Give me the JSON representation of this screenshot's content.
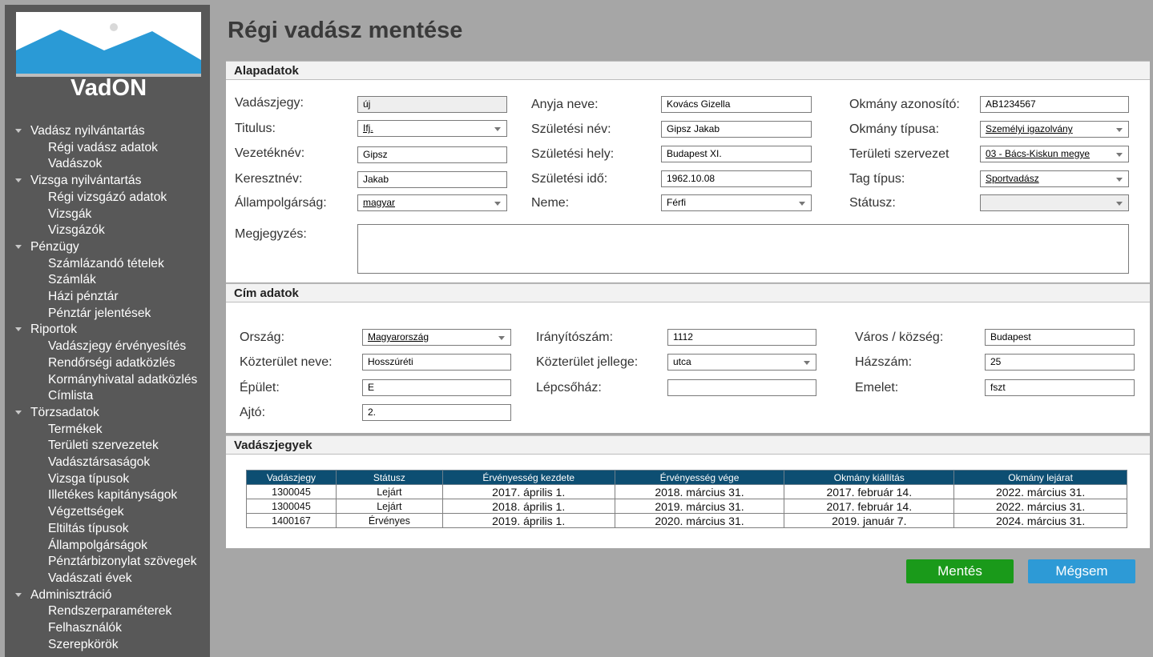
{
  "app": {
    "brand": "VadON",
    "page_title": "Régi vadász mentése"
  },
  "sidebar": {
    "groups": [
      {
        "label": "Vadász nyilvántartás",
        "items": [
          "Régi vadász adatok",
          "Vadászok"
        ]
      },
      {
        "label": "Vizsga nyilvántartás",
        "items": [
          "Régi vizsgázó adatok",
          "Vizsgák",
          "Vizsgázók"
        ]
      },
      {
        "label": "Pénzügy",
        "items": [
          "Számlázandó tételek",
          "Számlák",
          "Házi pénztár",
          "Pénztár jelentések"
        ]
      },
      {
        "label": "Riportok",
        "items": [
          "Vadászjegy érvényesítés",
          "Rendőrségi adatközlés",
          "Kormányhivatal adatközlés",
          "Címlista"
        ]
      },
      {
        "label": "Törzsadatok",
        "items": [
          "Termékek",
          "Területi szervezetek",
          "Vadásztársaságok",
          "Vizsga típusok",
          "Illetékes kapitányságok",
          "Végzettségek",
          "Eltiltás típusok",
          "Állampolgárságok",
          "Pénztárbizonylat szövegek",
          "Vadászati évek"
        ]
      },
      {
        "label": "Adminisztráció",
        "items": [
          "Rendszerparaméterek",
          "Felhasználók",
          "Szerepkörök"
        ]
      }
    ]
  },
  "basic": {
    "section_title": "Alapadatok",
    "license_label": "Vadászjegy:",
    "license_value": "új",
    "title_label": "Titulus:",
    "title_value": "Ifj.",
    "lastname_label": "Vezetéknév:",
    "lastname_value": "Gipsz",
    "firstname_label": "Keresztnév:",
    "firstname_value": "Jakab",
    "citizenship_label": "Állampolgárság:",
    "citizenship_value": "magyar",
    "mother_label": "Anyja neve:",
    "mother_value": "Kovács Gizella",
    "birthname_label": "Születési név:",
    "birthname_value": "Gipsz Jakab",
    "birthplace_label": "Születési hely:",
    "birthplace_value": "Budapest XI.",
    "birthdate_label": "Születési idő:",
    "birthdate_value": "1962.10.08",
    "gender_label": "Neme:",
    "gender_value": "Férfi",
    "docid_label": "Okmány azonosító:",
    "docid_value": "AB1234567",
    "doctype_label": "Okmány típusa:",
    "doctype_value": "Személyi igazolvány",
    "org_label": "Területi szervezet",
    "org_value": "03 - Bács-Kiskun megye",
    "member_label": "Tag típus:",
    "member_value": "Sportvadász",
    "status_label": "Státusz:",
    "status_value": "",
    "notes_label": "Megjegyzés:"
  },
  "address": {
    "section_title": "Cím adatok",
    "country_label": "Ország:",
    "country_value": "Magyarország",
    "street_label": "Közterület neve:",
    "street_value": "Hosszúréti",
    "building_label": "Épület:",
    "building_value": "E",
    "door_label": "Ajtó:",
    "door_value": "2.",
    "zip_label": "Irányítószám:",
    "zip_value": "1112",
    "streettype_label": "Közterület jellege:",
    "streettype_value": "utca",
    "stair_label": "Lépcsőház:",
    "stair_value": "",
    "city_label": "Város / község:",
    "city_value": "Budapest",
    "houseno_label": "Házszám:",
    "houseno_value": "25",
    "floor_label": "Emelet:",
    "floor_value": "fszt"
  },
  "tickets": {
    "section_title": "Vadászjegyek",
    "columns": [
      "Vadászjegy",
      "Státusz",
      "Érvényesség kezdete",
      "Érvényesség vége",
      "Okmány kiállítás",
      "Okmány lejárat"
    ],
    "rows": [
      [
        "1300045",
        "Lejárt",
        "2017. április 1.",
        "2018. március 31.",
        "2017. február 14.",
        "2022. március 31."
      ],
      [
        "1300045",
        "Lejárt",
        "2018. április 1.",
        "2019. március 31.",
        "2017. február 14.",
        "2022. március 31."
      ],
      [
        "1400167",
        "Érvényes",
        "2019. április 1.",
        "2020. március 31.",
        "2019. január 7.",
        "2024. március 31."
      ]
    ]
  },
  "actions": {
    "save_label": "Mentés",
    "cancel_label": "Mégsem"
  },
  "colors": {
    "save": "#1a9a1a",
    "cancel": "#2d9ad6",
    "table_header": "#0d4e72",
    "sidebar": "#585858"
  }
}
